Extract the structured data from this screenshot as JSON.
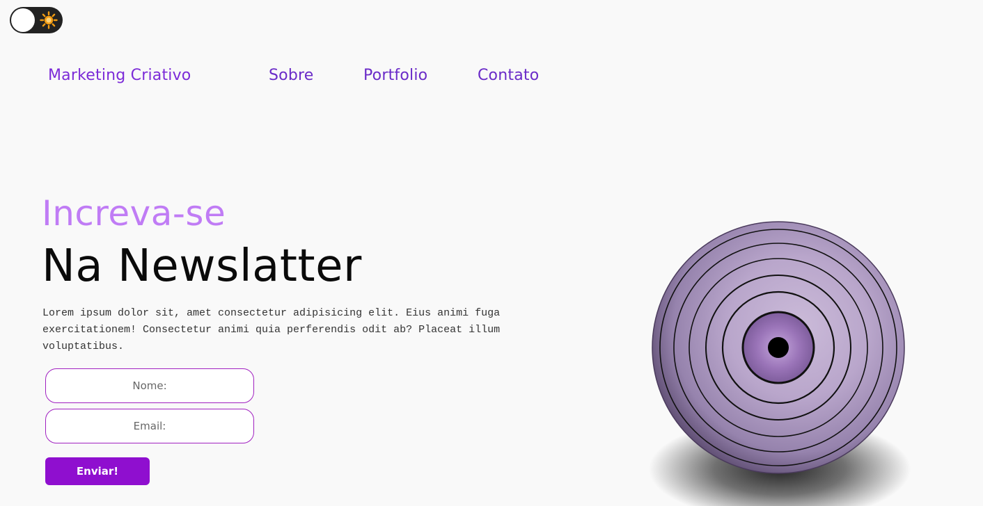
{
  "theme_toggle": {
    "icon": "sun-icon",
    "sun_color": "#f39c12"
  },
  "nav": {
    "brand": "Marketing Criativo",
    "links": [
      "Sobre",
      "Portfolio",
      "Contato"
    ]
  },
  "hero": {
    "eyebrow": "Increva-se",
    "headline": "Na Newslatter",
    "body": "Lorem ipsum dolor sit, amet consectetur adipisicing elit. Eius animi fuga exercitationem! Consectetur animi quia perferendis odit ab? Placeat illum voluptatibus."
  },
  "form": {
    "name_placeholder": "Nome:",
    "email_placeholder": "Email:",
    "submit_label": "Enviar!"
  },
  "colors": {
    "accent": "#8f0fcf",
    "nav_text": "#6a2bc8",
    "eyebrow": "#c07cf5",
    "background": "#f9f9f9",
    "sphere": "#b8a5cc"
  }
}
